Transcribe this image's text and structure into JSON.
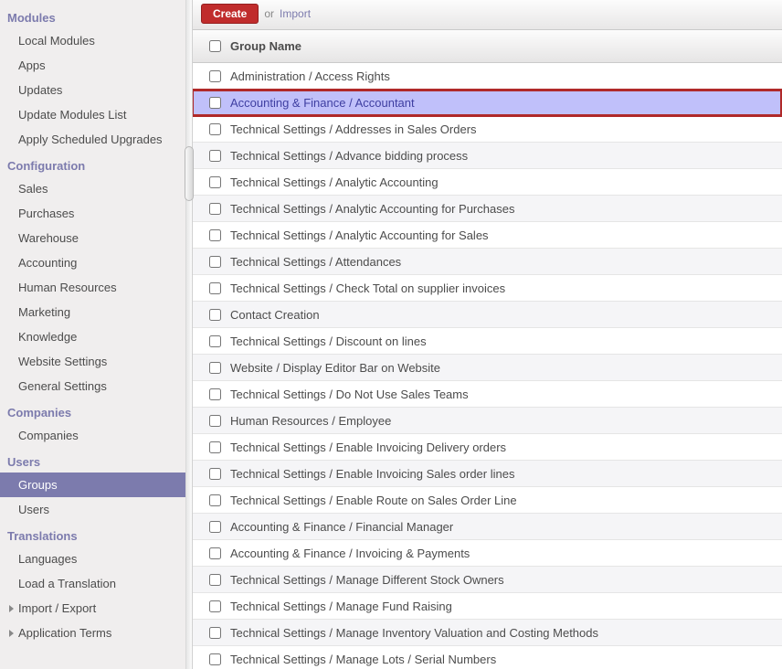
{
  "toolbar": {
    "create_label": "Create",
    "or_label": "or",
    "import_label": "Import"
  },
  "list": {
    "header_group_name": "Group Name",
    "rows": [
      {
        "name": "Administration / Access Rights",
        "highlighted": false
      },
      {
        "name": "Accounting & Finance / Accountant",
        "highlighted": true
      },
      {
        "name": "Technical Settings / Addresses in Sales Orders",
        "highlighted": false
      },
      {
        "name": "Technical Settings / Advance bidding process",
        "highlighted": false
      },
      {
        "name": "Technical Settings / Analytic Accounting",
        "highlighted": false
      },
      {
        "name": "Technical Settings / Analytic Accounting for Purchases",
        "highlighted": false
      },
      {
        "name": "Technical Settings / Analytic Accounting for Sales",
        "highlighted": false
      },
      {
        "name": "Technical Settings / Attendances",
        "highlighted": false
      },
      {
        "name": "Technical Settings / Check Total on supplier invoices",
        "highlighted": false
      },
      {
        "name": "Contact Creation",
        "highlighted": false
      },
      {
        "name": "Technical Settings / Discount on lines",
        "highlighted": false
      },
      {
        "name": "Website / Display Editor Bar on Website",
        "highlighted": false
      },
      {
        "name": "Technical Settings / Do Not Use Sales Teams",
        "highlighted": false
      },
      {
        "name": "Human Resources / Employee",
        "highlighted": false
      },
      {
        "name": "Technical Settings / Enable Invoicing Delivery orders",
        "highlighted": false
      },
      {
        "name": "Technical Settings / Enable Invoicing Sales order lines",
        "highlighted": false
      },
      {
        "name": "Technical Settings / Enable Route on Sales Order Line",
        "highlighted": false
      },
      {
        "name": "Accounting & Finance / Financial Manager",
        "highlighted": false
      },
      {
        "name": "Accounting & Finance / Invoicing & Payments",
        "highlighted": false
      },
      {
        "name": "Technical Settings / Manage Different Stock Owners",
        "highlighted": false
      },
      {
        "name": "Technical Settings / Manage Fund Raising",
        "highlighted": false
      },
      {
        "name": "Technical Settings / Manage Inventory Valuation and Costing Methods",
        "highlighted": false
      },
      {
        "name": "Technical Settings / Manage Lots / Serial Numbers",
        "highlighted": false
      }
    ]
  },
  "sidebar": {
    "sections": [
      {
        "header": "Modules",
        "items": [
          {
            "label": "Local Modules"
          },
          {
            "label": "Apps"
          },
          {
            "label": "Updates"
          },
          {
            "label": "Update Modules List"
          },
          {
            "label": "Apply Scheduled Upgrades"
          }
        ]
      },
      {
        "header": "Configuration",
        "items": [
          {
            "label": "Sales"
          },
          {
            "label": "Purchases"
          },
          {
            "label": "Warehouse"
          },
          {
            "label": "Accounting"
          },
          {
            "label": "Human Resources"
          },
          {
            "label": "Marketing"
          },
          {
            "label": "Knowledge"
          },
          {
            "label": "Website Settings"
          },
          {
            "label": "General Settings"
          }
        ]
      },
      {
        "header": "Companies",
        "items": [
          {
            "label": "Companies"
          }
        ]
      },
      {
        "header": "Users",
        "items": [
          {
            "label": "Groups",
            "active": true
          },
          {
            "label": "Users"
          }
        ]
      },
      {
        "header": "Translations",
        "items": [
          {
            "label": "Languages"
          },
          {
            "label": "Load a Translation"
          },
          {
            "label": "Import / Export",
            "caret": true
          },
          {
            "label": "Application Terms",
            "caret": true
          }
        ]
      }
    ]
  }
}
